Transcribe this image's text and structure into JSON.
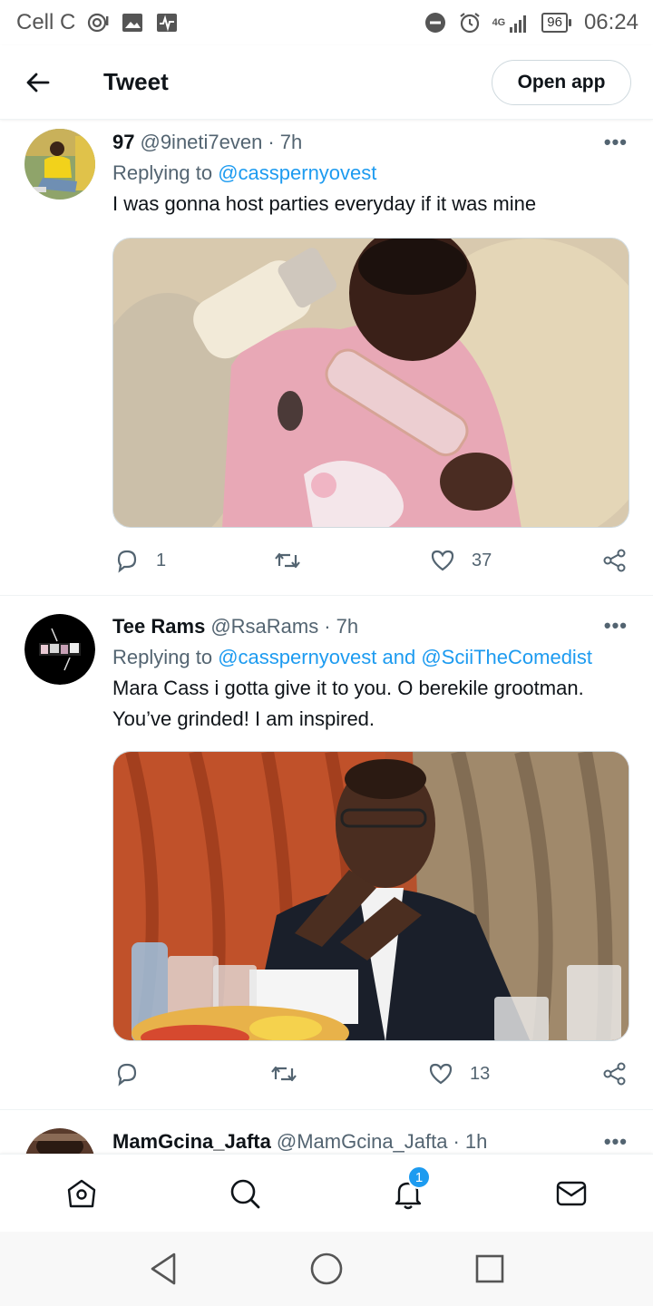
{
  "status_bar": {
    "carrier": "Cell C",
    "network": "4G",
    "battery": "96",
    "time": "06:24"
  },
  "header": {
    "title": "Tweet",
    "open_app_label": "Open app"
  },
  "tweets": [
    {
      "name": "97",
      "handle": "@9ineti7even",
      "time": "· 7h",
      "replying_prefix": "Replying to",
      "replying_to": "@casspernyovest",
      "replying_more": "",
      "text": "I was gonna host parties everyday if it was mine",
      "replies": "1",
      "retweets": "",
      "likes": "37"
    },
    {
      "name": "Tee Rams",
      "handle": "@RsaRams",
      "time": "· 7h",
      "replying_prefix": "Replying to",
      "replying_to": "@casspernyovest and @SciiTheComedist",
      "replying_more": "",
      "text": "Mara Cass i gotta give it to you. O berekile grootman. You’ve grinded! I am inspired.",
      "replies": "",
      "retweets": "",
      "likes": "13"
    },
    {
      "name": "MamGcina_Jafta",
      "handle": "@MamGcina_Jafta",
      "time": "· 1h"
    }
  ],
  "bottom_nav": {
    "notifications_badge": "1"
  },
  "colors": {
    "accent": "#1d9bf0",
    "text": "#0f1419",
    "secondary": "#536471"
  }
}
